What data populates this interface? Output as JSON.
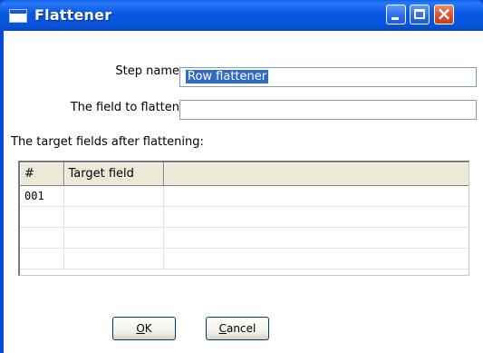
{
  "window": {
    "title": "Flattener",
    "controls": {
      "minimize": "minimize",
      "maximize": "maximize",
      "close": "close"
    }
  },
  "form": {
    "step_name_label": "Step name",
    "step_name_value": "Row flattener",
    "field_label": "The field to flatten",
    "field_value": "",
    "target_label": "The target fields after flattening:"
  },
  "table": {
    "columns": [
      "#",
      "Target field"
    ],
    "rows": [
      {
        "num": "001",
        "target_field": ""
      },
      {
        "num": "",
        "target_field": ""
      },
      {
        "num": "",
        "target_field": ""
      },
      {
        "num": "",
        "target_field": ""
      }
    ]
  },
  "buttons": {
    "ok_mnemonic": "O",
    "ok_rest": "K",
    "cancel_mnemonic": "C",
    "cancel_rest": "ancel"
  },
  "colors": {
    "titlebar": "#0a5ae6",
    "close_button": "#d4502c",
    "selection": "#316ac5"
  }
}
